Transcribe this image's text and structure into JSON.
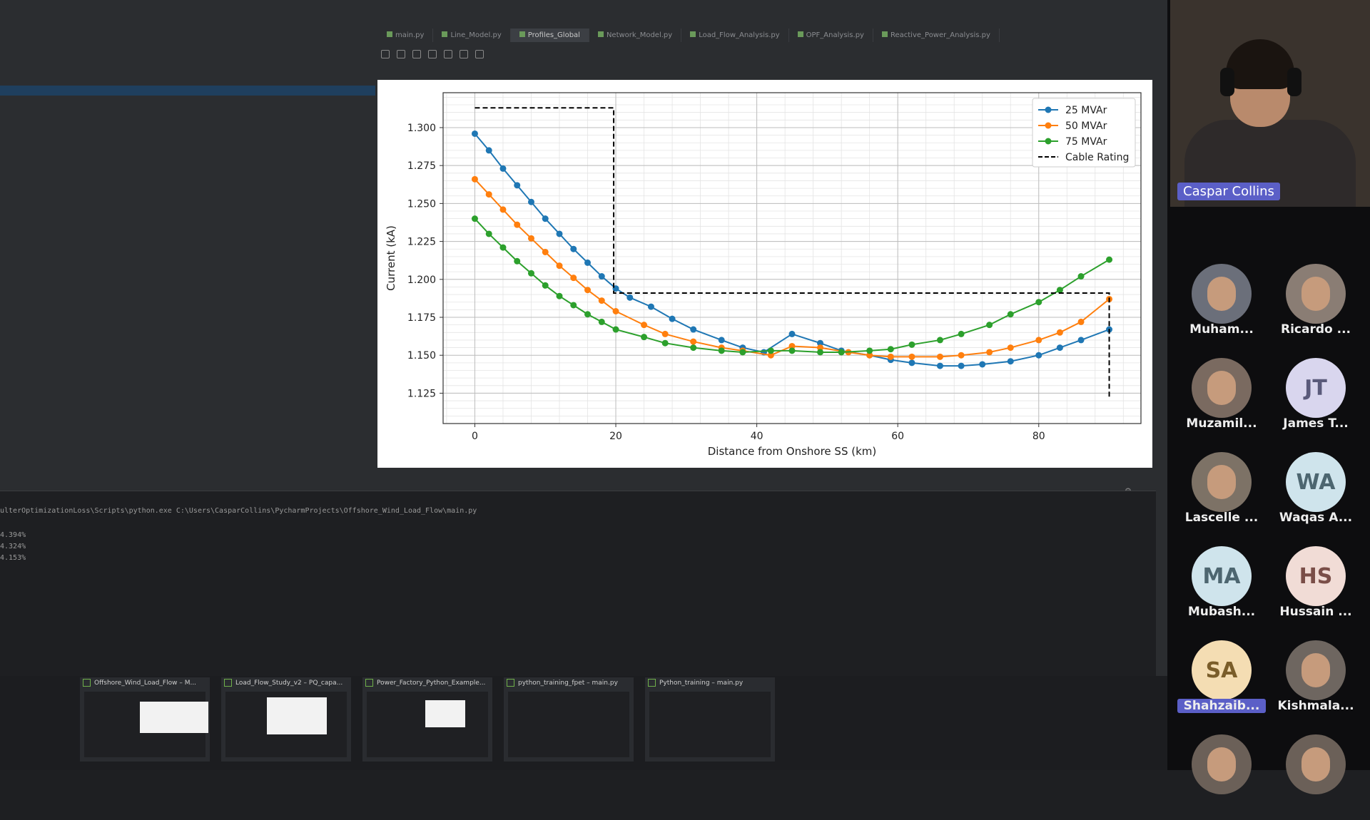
{
  "ide": {
    "tabs": [
      {
        "label": "main.py",
        "active": false
      },
      {
        "label": "Line_Model.py",
        "active": false
      },
      {
        "label": "Profiles_Global",
        "active": true
      },
      {
        "label": "Network_Model.py",
        "active": false
      },
      {
        "label": "Load_Flow_Analysis.py",
        "active": false
      },
      {
        "label": "OPF_Analysis.py",
        "active": false
      },
      {
        "label": "Reactive_Power_Analysis.py",
        "active": false
      }
    ],
    "console_lines": [
      "ulterOptimizationLoss\\Scripts\\python.exe C:\\Users\\CasparCollins\\PycharmProjects\\Offshore_Wind_Load_Flow\\main.py",
      "4.394%",
      "4.324%",
      "4.153%"
    ],
    "taskbar_thumbs": [
      {
        "title": "Offshore_Wind_Load_Flow – M..."
      },
      {
        "title": "Load_Flow_Study_v2 – PQ_capa..."
      },
      {
        "title": "Power_Factory_Python_Example..."
      },
      {
        "title": "python_training_fpet – main.py"
      },
      {
        "title": "Python_training – main.py"
      }
    ]
  },
  "chart_data": {
    "type": "line",
    "xlabel": "Distance from Onshore SS (km)",
    "ylabel": "Current (kA)",
    "xlim": [
      -4.5,
      94.5
    ],
    "ylim": [
      1.105,
      1.323
    ],
    "xticks": [
      0,
      20,
      40,
      60,
      80
    ],
    "yticks": [
      1.125,
      1.15,
      1.175,
      1.2,
      1.225,
      1.25,
      1.275,
      1.3
    ],
    "ytick_labels": [
      "1.125",
      "1.150",
      "1.175",
      "1.200",
      "1.225",
      "1.250",
      "1.275",
      "1.300"
    ],
    "grid": true,
    "legend_position": "top-right",
    "x": [
      0,
      2,
      4,
      6,
      8,
      10,
      12,
      14,
      16,
      18,
      20,
      22,
      24,
      26,
      28,
      30,
      32,
      34,
      36,
      38,
      40,
      42,
      44,
      46,
      48,
      50,
      52,
      54,
      56,
      58,
      60,
      62,
      64,
      66,
      68,
      70,
      72,
      74,
      76,
      78,
      80,
      82,
      84,
      86,
      88,
      90
    ],
    "series": [
      {
        "name": "25 MVAr",
        "color": "#1f77b4",
        "points": [
          [
            0,
            1.296
          ],
          [
            2,
            1.285
          ],
          [
            4,
            1.273
          ],
          [
            6,
            1.262
          ],
          [
            8,
            1.251
          ],
          [
            10,
            1.24
          ],
          [
            12,
            1.23
          ],
          [
            14,
            1.22
          ],
          [
            16,
            1.211
          ],
          [
            18,
            1.202
          ],
          [
            20,
            1.194
          ],
          [
            22,
            1.188
          ],
          [
            25,
            1.182
          ],
          [
            28,
            1.174
          ],
          [
            31,
            1.167
          ],
          [
            35,
            1.16
          ],
          [
            38,
            1.155
          ],
          [
            41,
            1.152
          ],
          [
            45,
            1.164
          ],
          [
            49,
            1.158
          ],
          [
            52,
            1.153
          ],
          [
            56,
            1.15
          ],
          [
            59,
            1.147
          ],
          [
            62,
            1.145
          ],
          [
            66,
            1.143
          ],
          [
            69,
            1.143
          ],
          [
            72,
            1.144
          ],
          [
            76,
            1.146
          ],
          [
            80,
            1.15
          ],
          [
            83,
            1.155
          ],
          [
            86,
            1.16
          ],
          [
            90,
            1.167
          ]
        ]
      },
      {
        "name": "50 MVAr",
        "color": "#ff7f0e",
        "points": [
          [
            0,
            1.266
          ],
          [
            2,
            1.256
          ],
          [
            4,
            1.246
          ],
          [
            6,
            1.236
          ],
          [
            8,
            1.227
          ],
          [
            10,
            1.218
          ],
          [
            12,
            1.209
          ],
          [
            14,
            1.201
          ],
          [
            16,
            1.193
          ],
          [
            18,
            1.186
          ],
          [
            20,
            1.179
          ],
          [
            24,
            1.17
          ],
          [
            27,
            1.164
          ],
          [
            31,
            1.159
          ],
          [
            35,
            1.155
          ],
          [
            38,
            1.153
          ],
          [
            42,
            1.15
          ],
          [
            45,
            1.156
          ],
          [
            49,
            1.155
          ],
          [
            53,
            1.152
          ],
          [
            56,
            1.15
          ],
          [
            59,
            1.149
          ],
          [
            62,
            1.149
          ],
          [
            66,
            1.149
          ],
          [
            69,
            1.15
          ],
          [
            73,
            1.152
          ],
          [
            76,
            1.155
          ],
          [
            80,
            1.16
          ],
          [
            83,
            1.165
          ],
          [
            86,
            1.172
          ],
          [
            90,
            1.187
          ]
        ]
      },
      {
        "name": "75 MVAr",
        "color": "#2ca02c",
        "points": [
          [
            0,
            1.24
          ],
          [
            2,
            1.23
          ],
          [
            4,
            1.221
          ],
          [
            6,
            1.212
          ],
          [
            8,
            1.204
          ],
          [
            10,
            1.196
          ],
          [
            12,
            1.189
          ],
          [
            14,
            1.183
          ],
          [
            16,
            1.177
          ],
          [
            18,
            1.172
          ],
          [
            20,
            1.167
          ],
          [
            24,
            1.162
          ],
          [
            27,
            1.158
          ],
          [
            31,
            1.155
          ],
          [
            35,
            1.153
          ],
          [
            38,
            1.152
          ],
          [
            42,
            1.153
          ],
          [
            45,
            1.153
          ],
          [
            49,
            1.152
          ],
          [
            52,
            1.152
          ],
          [
            56,
            1.153
          ],
          [
            59,
            1.154
          ],
          [
            62,
            1.157
          ],
          [
            66,
            1.16
          ],
          [
            69,
            1.164
          ],
          [
            73,
            1.17
          ],
          [
            76,
            1.177
          ],
          [
            80,
            1.185
          ],
          [
            83,
            1.193
          ],
          [
            86,
            1.202
          ],
          [
            90,
            1.213
          ]
        ]
      },
      {
        "name": "Cable Rating",
        "color": "#000000",
        "dashed": true,
        "points": [
          [
            0,
            1.313
          ],
          [
            19.7,
            1.313
          ],
          [
            19.7,
            1.191
          ],
          [
            90,
            1.191
          ],
          [
            90,
            1.122
          ]
        ]
      }
    ]
  },
  "meeting": {
    "speaker": {
      "name": "Caspar Collins"
    },
    "participants": [
      {
        "name": "Muham...",
        "initials": "",
        "photo": true,
        "bg": "#6b6f7a",
        "fg": "#ffffff"
      },
      {
        "name": "Ricardo ...",
        "initials": "",
        "photo": true,
        "bg": "#8a7d74",
        "fg": "#ffffff"
      },
      {
        "name": "Muzamil...",
        "initials": "",
        "photo": true,
        "bg": "#7a6a60",
        "fg": "#ffffff"
      },
      {
        "name": "James T...",
        "initials": "JT",
        "photo": false,
        "bg": "#d9d6ee",
        "fg": "#5a5a7a"
      },
      {
        "name": "Lascelle ...",
        "initials": "",
        "photo": true,
        "bg": "#7d7266",
        "fg": "#ffffff"
      },
      {
        "name": "Waqas A...",
        "initials": "WA",
        "photo": false,
        "bg": "#cfe4ec",
        "fg": "#4d6670"
      },
      {
        "name": "Mubash...",
        "initials": "MA",
        "photo": false,
        "bg": "#cfe4ec",
        "fg": "#4d6670"
      },
      {
        "name": "Hussain ...",
        "initials": "HS",
        "photo": false,
        "bg": "#f1dcd6",
        "fg": "#7a4e48"
      },
      {
        "name": "Shahzaib...",
        "initials": "SA",
        "photo": false,
        "bg": "#f4ddb3",
        "fg": "#7a5d2a",
        "highlight": true
      },
      {
        "name": "Kishmala...",
        "initials": "",
        "photo": true,
        "bg": "#6e6660",
        "fg": "#ffffff"
      },
      {
        "name": "",
        "initials": "",
        "photo": true,
        "bg": "#6b6058",
        "fg": "#ffffff"
      },
      {
        "name": "",
        "initials": "",
        "photo": true,
        "bg": "#6b6058",
        "fg": "#ffffff"
      }
    ]
  }
}
